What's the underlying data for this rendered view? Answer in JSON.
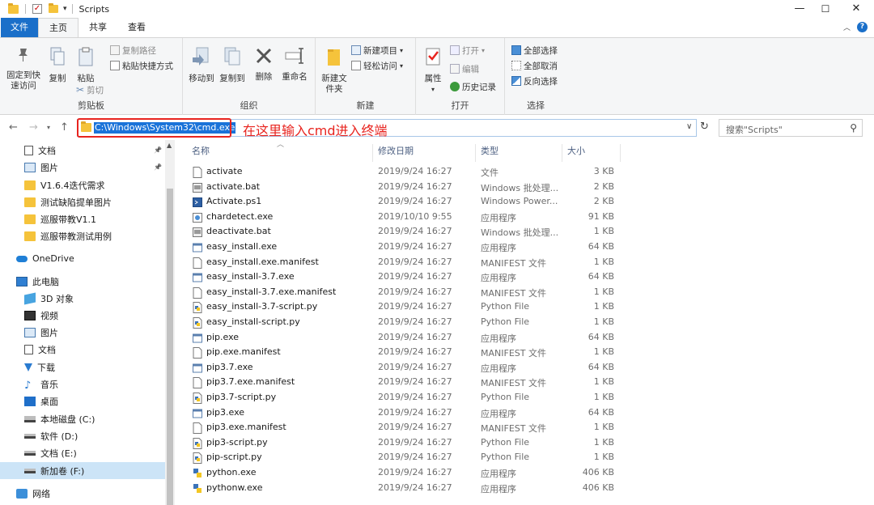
{
  "window": {
    "title": "Scripts",
    "minimize": "—",
    "maximize": "☐",
    "close": "✕"
  },
  "ribbon": {
    "tabs": [
      {
        "label": "文件"
      },
      {
        "label": "主页"
      },
      {
        "label": "共享"
      },
      {
        "label": "查看"
      }
    ],
    "groups": {
      "clipboard": {
        "label": "剪贴板",
        "pin_quick_access": "固定到快速访问",
        "copy": "复制",
        "paste": "粘贴",
        "copy_path": "复制路径",
        "paste_shortcut": "粘贴快捷方式",
        "cut": "剪切"
      },
      "organize": {
        "label": "组织",
        "move_to": "移动到",
        "copy_to": "复制到",
        "delete": "删除",
        "rename": "重命名"
      },
      "new": {
        "label": "新建",
        "new_folder": "新建文件夹",
        "new_item": "新建项目",
        "easy_access": "轻松访问"
      },
      "open": {
        "label": "打开",
        "properties": "属性",
        "open": "打开",
        "edit": "编辑",
        "history": "历史记录"
      },
      "select": {
        "label": "选择",
        "select_all": "全部选择",
        "select_none": "全部取消",
        "invert": "反向选择"
      }
    }
  },
  "address": {
    "path": "C:\\Windows\\System32\\cmd.exe",
    "annotation": "在这里输入cmd进入终端",
    "search_placeholder": "搜索\"Scripts\""
  },
  "nav_pane": {
    "items": [
      {
        "label": "文档",
        "icon": "document-icon",
        "pinned": true
      },
      {
        "label": "图片",
        "icon": "picture-icon",
        "pinned": true
      },
      {
        "label": "V1.6.4迭代需求",
        "icon": "folder-icon"
      },
      {
        "label": "测试缺陷提单图片",
        "icon": "folder-icon"
      },
      {
        "label": "巡服带教V1.1",
        "icon": "folder-icon"
      },
      {
        "label": "巡服带教测试用例",
        "icon": "folder-icon"
      },
      {
        "label": "OneDrive",
        "icon": "cloud-icon"
      },
      {
        "label": "此电脑",
        "icon": "computer-icon"
      },
      {
        "label": "3D 对象",
        "icon": "cube-icon"
      },
      {
        "label": "视频",
        "icon": "video-icon"
      },
      {
        "label": "图片",
        "icon": "picture-icon"
      },
      {
        "label": "文档",
        "icon": "document-icon"
      },
      {
        "label": "下载",
        "icon": "download-icon"
      },
      {
        "label": "音乐",
        "icon": "music-icon"
      },
      {
        "label": "桌面",
        "icon": "desktop-icon"
      },
      {
        "label": "本地磁盘 (C:)",
        "icon": "os-drive-icon"
      },
      {
        "label": "软件 (D:)",
        "icon": "drive-icon"
      },
      {
        "label": "文档 (E:)",
        "icon": "drive-icon"
      },
      {
        "label": "新加卷 (F:)",
        "icon": "drive-icon",
        "selected": true
      },
      {
        "label": "网络",
        "icon": "network-icon"
      }
    ]
  },
  "file_list": {
    "columns": {
      "name": "名称",
      "date": "修改日期",
      "type": "类型",
      "size": "大小"
    },
    "files": [
      {
        "name": "activate",
        "date": "2019/9/24 16:27",
        "type": "文件",
        "size": "3 KB",
        "icon": "blank-file-icon"
      },
      {
        "name": "activate.bat",
        "date": "2019/9/24 16:27",
        "type": "Windows 批处理...",
        "size": "2 KB",
        "icon": "batch-file-icon"
      },
      {
        "name": "Activate.ps1",
        "date": "2019/9/24 16:27",
        "type": "Windows Power...",
        "size": "2 KB",
        "icon": "powershell-file-icon"
      },
      {
        "name": "chardetect.exe",
        "date": "2019/10/10 9:55",
        "type": "应用程序",
        "size": "91 KB",
        "icon": "exe-alt-icon"
      },
      {
        "name": "deactivate.bat",
        "date": "2019/9/24 16:27",
        "type": "Windows 批处理...",
        "size": "1 KB",
        "icon": "batch-file-icon"
      },
      {
        "name": "easy_install.exe",
        "date": "2019/9/24 16:27",
        "type": "应用程序",
        "size": "64 KB",
        "icon": "exe-file-icon"
      },
      {
        "name": "easy_install.exe.manifest",
        "date": "2019/9/24 16:27",
        "type": "MANIFEST 文件",
        "size": "1 KB",
        "icon": "blank-file-icon"
      },
      {
        "name": "easy_install-3.7.exe",
        "date": "2019/9/24 16:27",
        "type": "应用程序",
        "size": "64 KB",
        "icon": "exe-file-icon"
      },
      {
        "name": "easy_install-3.7.exe.manifest",
        "date": "2019/9/24 16:27",
        "type": "MANIFEST 文件",
        "size": "1 KB",
        "icon": "blank-file-icon"
      },
      {
        "name": "easy_install-3.7-script.py",
        "date": "2019/9/24 16:27",
        "type": "Python File",
        "size": "1 KB",
        "icon": "python-file-icon"
      },
      {
        "name": "easy_install-script.py",
        "date": "2019/9/24 16:27",
        "type": "Python File",
        "size": "1 KB",
        "icon": "python-file-icon"
      },
      {
        "name": "pip.exe",
        "date": "2019/9/24 16:27",
        "type": "应用程序",
        "size": "64 KB",
        "icon": "exe-file-icon"
      },
      {
        "name": "pip.exe.manifest",
        "date": "2019/9/24 16:27",
        "type": "MANIFEST 文件",
        "size": "1 KB",
        "icon": "blank-file-icon"
      },
      {
        "name": "pip3.7.exe",
        "date": "2019/9/24 16:27",
        "type": "应用程序",
        "size": "64 KB",
        "icon": "exe-file-icon"
      },
      {
        "name": "pip3.7.exe.manifest",
        "date": "2019/9/24 16:27",
        "type": "MANIFEST 文件",
        "size": "1 KB",
        "icon": "blank-file-icon"
      },
      {
        "name": "pip3.7-script.py",
        "date": "2019/9/24 16:27",
        "type": "Python File",
        "size": "1 KB",
        "icon": "python-file-icon"
      },
      {
        "name": "pip3.exe",
        "date": "2019/9/24 16:27",
        "type": "应用程序",
        "size": "64 KB",
        "icon": "exe-file-icon"
      },
      {
        "name": "pip3.exe.manifest",
        "date": "2019/9/24 16:27",
        "type": "MANIFEST 文件",
        "size": "1 KB",
        "icon": "blank-file-icon"
      },
      {
        "name": "pip3-script.py",
        "date": "2019/9/24 16:27",
        "type": "Python File",
        "size": "1 KB",
        "icon": "python-file-icon"
      },
      {
        "name": "pip-script.py",
        "date": "2019/9/24 16:27",
        "type": "Python File",
        "size": "1 KB",
        "icon": "python-file-icon"
      },
      {
        "name": "python.exe",
        "date": "2019/9/24 16:27",
        "type": "应用程序",
        "size": "406 KB",
        "icon": "python-exe-icon"
      },
      {
        "name": "pythonw.exe",
        "date": "2019/9/24 16:27",
        "type": "应用程序",
        "size": "406 KB",
        "icon": "python-exe-icon"
      }
    ]
  },
  "colors": {
    "accent": "#1a6fc9",
    "highlight_box": "#e8241f",
    "selection": "#cce4f7",
    "folder": "#f5c33b"
  }
}
